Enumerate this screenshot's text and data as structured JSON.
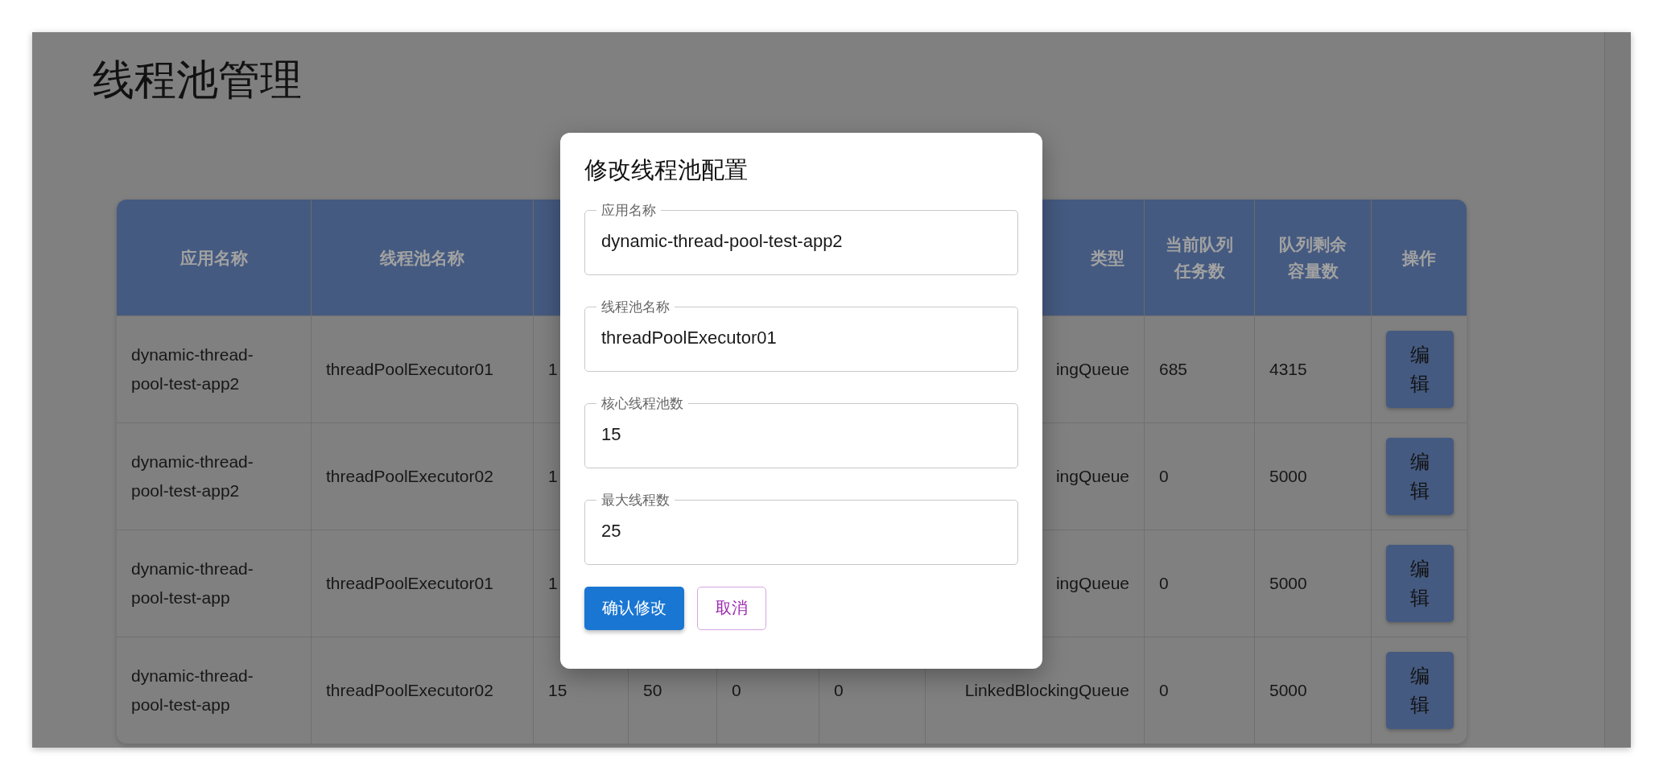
{
  "page": {
    "title": "线程池管理"
  },
  "table": {
    "columns": [
      {
        "label": "应用名称"
      },
      {
        "label": "线程池名称"
      },
      null,
      null,
      null,
      null,
      {
        "label": "类型"
      },
      {
        "label": "当前队列任务数"
      },
      {
        "label": "队列剩余容量数"
      },
      {
        "label": "操作"
      }
    ],
    "rows": [
      {
        "cells": [
          "dynamic-thread-pool-test-app2",
          "threadPoolExecutor01",
          "1",
          null,
          null,
          null,
          "ingQueue",
          "685",
          "4315"
        ],
        "action": "编辑"
      },
      {
        "cells": [
          "dynamic-thread-pool-test-app2",
          "threadPoolExecutor02",
          "1",
          null,
          null,
          null,
          "ingQueue",
          "0",
          "5000"
        ],
        "action": "编辑"
      },
      {
        "cells": [
          "dynamic-thread-pool-test-app",
          "threadPoolExecutor01",
          "1",
          null,
          null,
          null,
          "ingQueue",
          "0",
          "5000"
        ],
        "action": "编辑"
      },
      {
        "cells": [
          "dynamic-thread-pool-test-app",
          "threadPoolExecutor02",
          "15",
          "50",
          "0",
          "0",
          "LinkedBlockingQueue",
          "0",
          "5000"
        ],
        "action": "编辑"
      }
    ]
  },
  "dialog": {
    "title": "修改线程池配置",
    "fields": [
      {
        "label": "应用名称",
        "value": "dynamic-thread-pool-test-app2"
      },
      {
        "label": "线程池名称",
        "value": "threadPoolExecutor01"
      },
      {
        "label": "核心线程池数",
        "value": "15"
      },
      {
        "label": "最大线程数",
        "value": "25"
      }
    ],
    "buttons": [
      {
        "label": "确认修改",
        "kind": "primary"
      },
      {
        "label": "取消",
        "kind": "outlined"
      }
    ]
  }
}
